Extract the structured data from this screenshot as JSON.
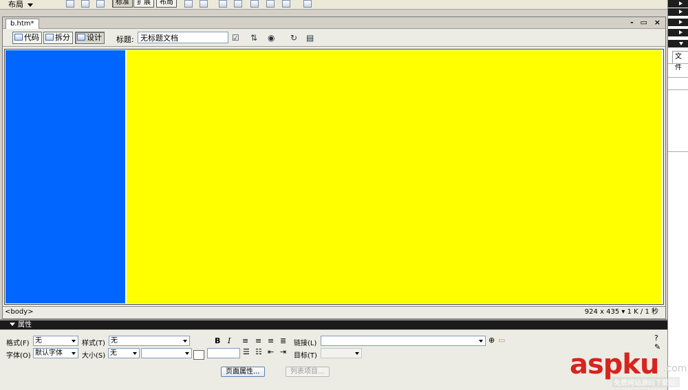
{
  "topbar": {
    "layout_label": "布局",
    "segments": [
      "标准",
      "扩展",
      "布局"
    ]
  },
  "document": {
    "tab_label": "b.htm*",
    "window_buttons": "- ▭ ×",
    "view_buttons": {
      "code": "代码",
      "split": "拆分",
      "design": "设计"
    },
    "title_label": "标题:",
    "title_value": "无标题文档",
    "tag_selector": "<body>",
    "status_info": "924 x 435 ▾ 1 K / 1 秒"
  },
  "canvas": {
    "left_color": "#0066ff",
    "right_color": "#ffff00"
  },
  "properties": {
    "header": "属性",
    "format_label": "格式(F)",
    "format_value": "无",
    "style_label": "样式(T)",
    "style_value": "无",
    "bold": "B",
    "italic": "I",
    "link_label": "链接(L)",
    "font_label": "字体(O)",
    "font_value": "默认字体",
    "size_label": "大小(S)",
    "size_value": "无",
    "target_label": "目标(T)",
    "page_props_button": "页面属性...",
    "list_items_button": "列表项目..."
  },
  "right_panel": {
    "files_tab": "文件"
  },
  "watermark": {
    "brand": "aspku",
    "suffix": ".com",
    "tagline": "免费网站源码下载站!"
  }
}
